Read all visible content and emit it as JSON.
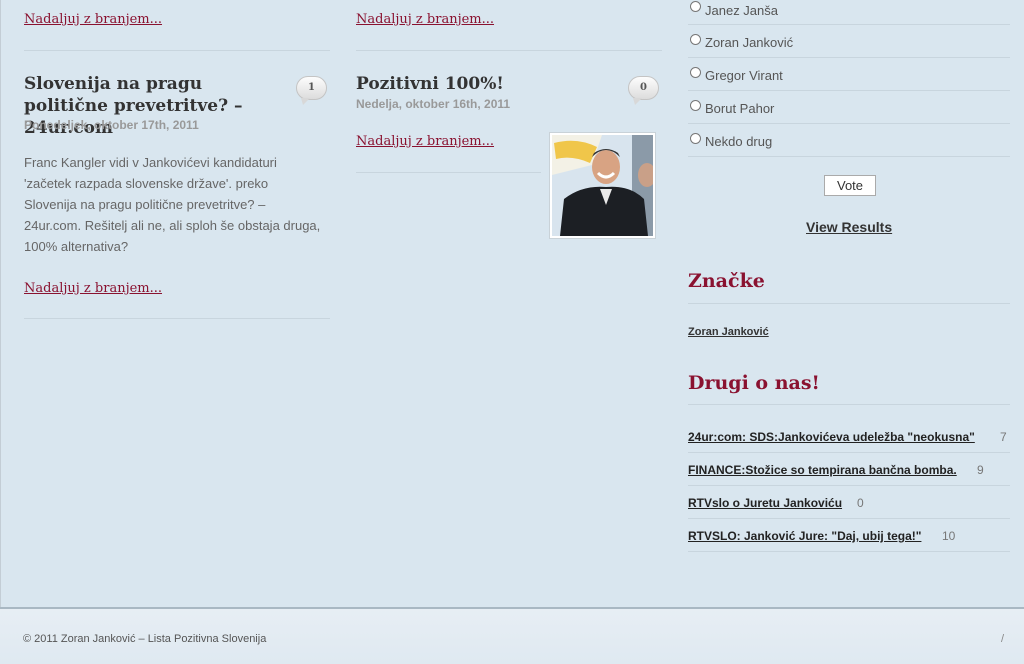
{
  "col1": {
    "top_more": "Nadaljuj z branjem...",
    "post": {
      "title": "Slovenija na pragu politične prevetritve? – 24ur.com",
      "date": "Ponedeljek, oktober 17th, 2011",
      "comments": "1",
      "excerpt": "Franc Kangler  vidi v Jankovićevi kandidaturi 'začetek razpada slovenske države'. preko Slovenija na pragu politične prevetritve? – 24ur.com. Rešitelj ali ne, ali sploh še obstaja druga, 100% alternativa?",
      "more": "Nadaljuj z branjem..."
    }
  },
  "col2": {
    "top_more": "Nadaljuj z branjem...",
    "post": {
      "title": "Pozitivni 100%!",
      "date": "Nedelja, oktober 16th, 2011",
      "comments": "0",
      "more": "Nadaljuj z branjem..."
    }
  },
  "poll": {
    "options": [
      "Janez Janša",
      "Zoran Janković",
      "Gregor Virant",
      "Borut Pahor",
      "Nekdo drug"
    ],
    "vote_label": "Vote",
    "view_results": "View Results"
  },
  "tags": {
    "title": "Značke",
    "items": [
      "Zoran Janković"
    ]
  },
  "links": {
    "title": "Drugi o nas!",
    "items": [
      {
        "text": "24ur:com: SDS:Jankovićeva udeležba \"neokusna\"",
        "count": "7"
      },
      {
        "text": "FINANCE:Stožice so tempirana bančna bomba.",
        "count": "9"
      },
      {
        "text": "RTVslo o Juretu Jankoviću",
        "count": "0"
      },
      {
        "text": "RTVSLO: Janković Jure: \"Daj, ubij tega!\"",
        "count": "10"
      }
    ]
  },
  "footer": {
    "copyright": "© 2011 Zoran Janković – Lista Pozitivna Slovenija",
    "slash": "/"
  },
  "colors": {
    "background": "#d9e6ef",
    "accent": "#8a1230",
    "rule": "#c8d5de"
  }
}
